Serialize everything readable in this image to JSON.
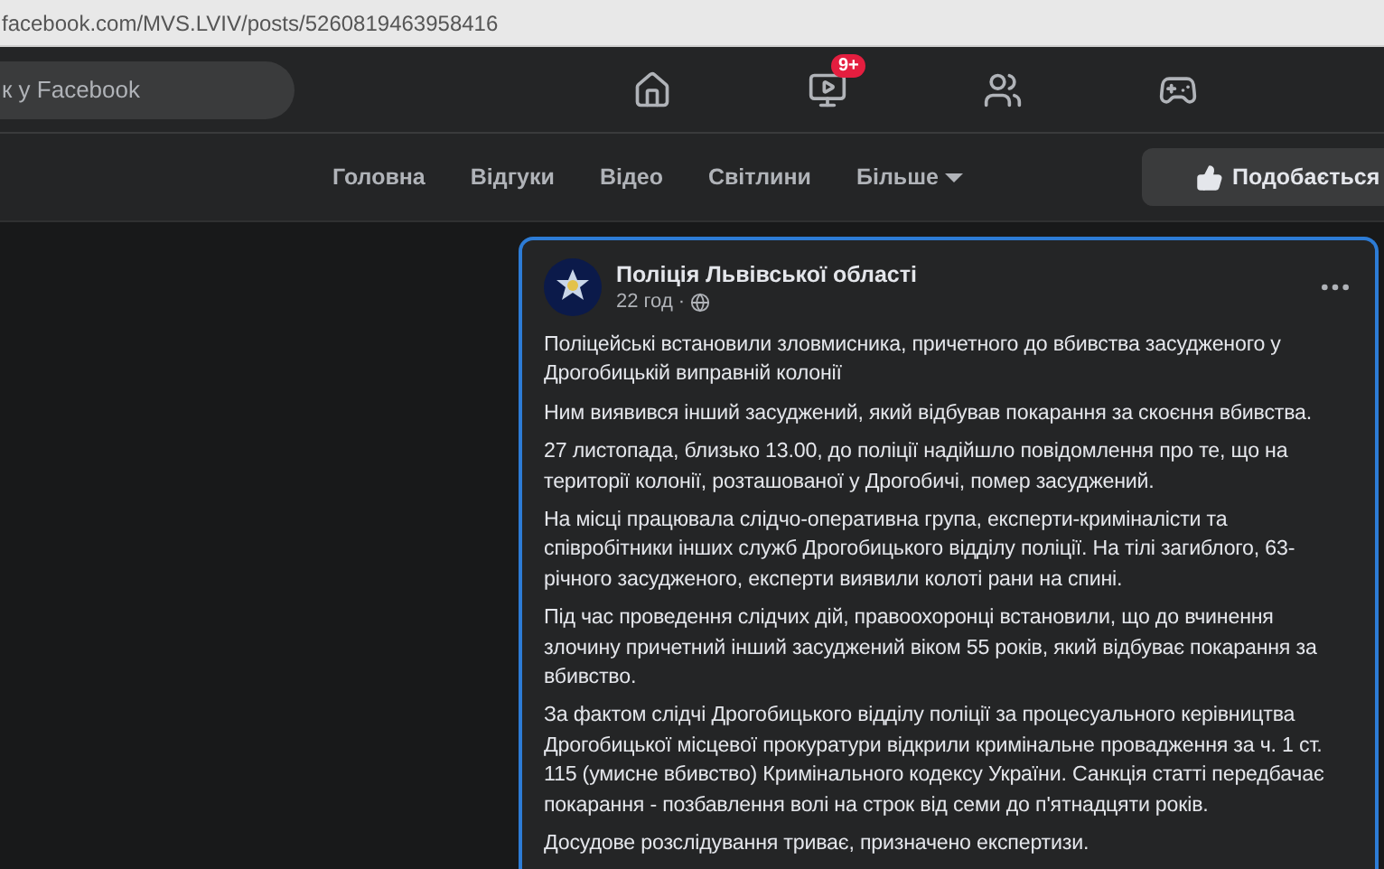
{
  "address_bar": {
    "url": "facebook.com/MVS.LVIV/posts/5260819463958416"
  },
  "top_nav": {
    "search": {
      "placeholder": "к у Facebook"
    },
    "icons": [
      {
        "kind": "home",
        "selected": false
      },
      {
        "kind": "video",
        "selected": false,
        "badge": "9+"
      },
      {
        "kind": "groups",
        "selected": false
      },
      {
        "kind": "gaming",
        "selected": false
      }
    ]
  },
  "page_tabs": [
    {
      "label": "Головна",
      "selected": false
    },
    {
      "label": "Відгуки",
      "selected": false
    },
    {
      "label": "Відео",
      "selected": false
    },
    {
      "label": "Світлини",
      "selected": false
    },
    {
      "label": "Більше",
      "selected": false,
      "dropdown": true
    }
  ],
  "like_button": {
    "label": "Подобається"
  },
  "post": {
    "author": "Поліція Львівської області",
    "time": "22 год ·",
    "focused": true,
    "paragraphs": [
      "Поліцейські  встановили зловмисника, причетного до вбивства засудженого у Дрогобицькій виправній колонії",
      "Ним виявився інший засуджений, який відбував покарання за скоєння вбивства.",
      "27 листопада, близько 13.00, до поліції надійшло повідомлення про те, що на території колонії, розташованої у Дрогобичі, помер засуджений.",
      "На місці працювала слідчо-оперативна група, експерти-криміналісти та співробітники інших служб Дрогобицького відділу поліції.  На тілі загиблого, 63-річного засудженого, експерти виявили колоті рани на спині.",
      "Під час проведення слідчих дій, правоохоронці встановили, що до вчинення злочину причетний інший засуджений віком 55 років, який відбуває покарання за вбивство.",
      "За фактом слідчі Дрогобицького відділу поліції за процесуального керівництва Дрогобицької місцевої прокуратури  відкрили кримінальне провадження за ч. 1 ст. 115 (умисне вбивство) Кримінального кодексу України. Санкція статті передбачає покарання - позбавлення волі на строк від семи до п'ятнадцяти років.",
      "Досудове розслідування триває, призначено експертизи."
    ]
  }
}
